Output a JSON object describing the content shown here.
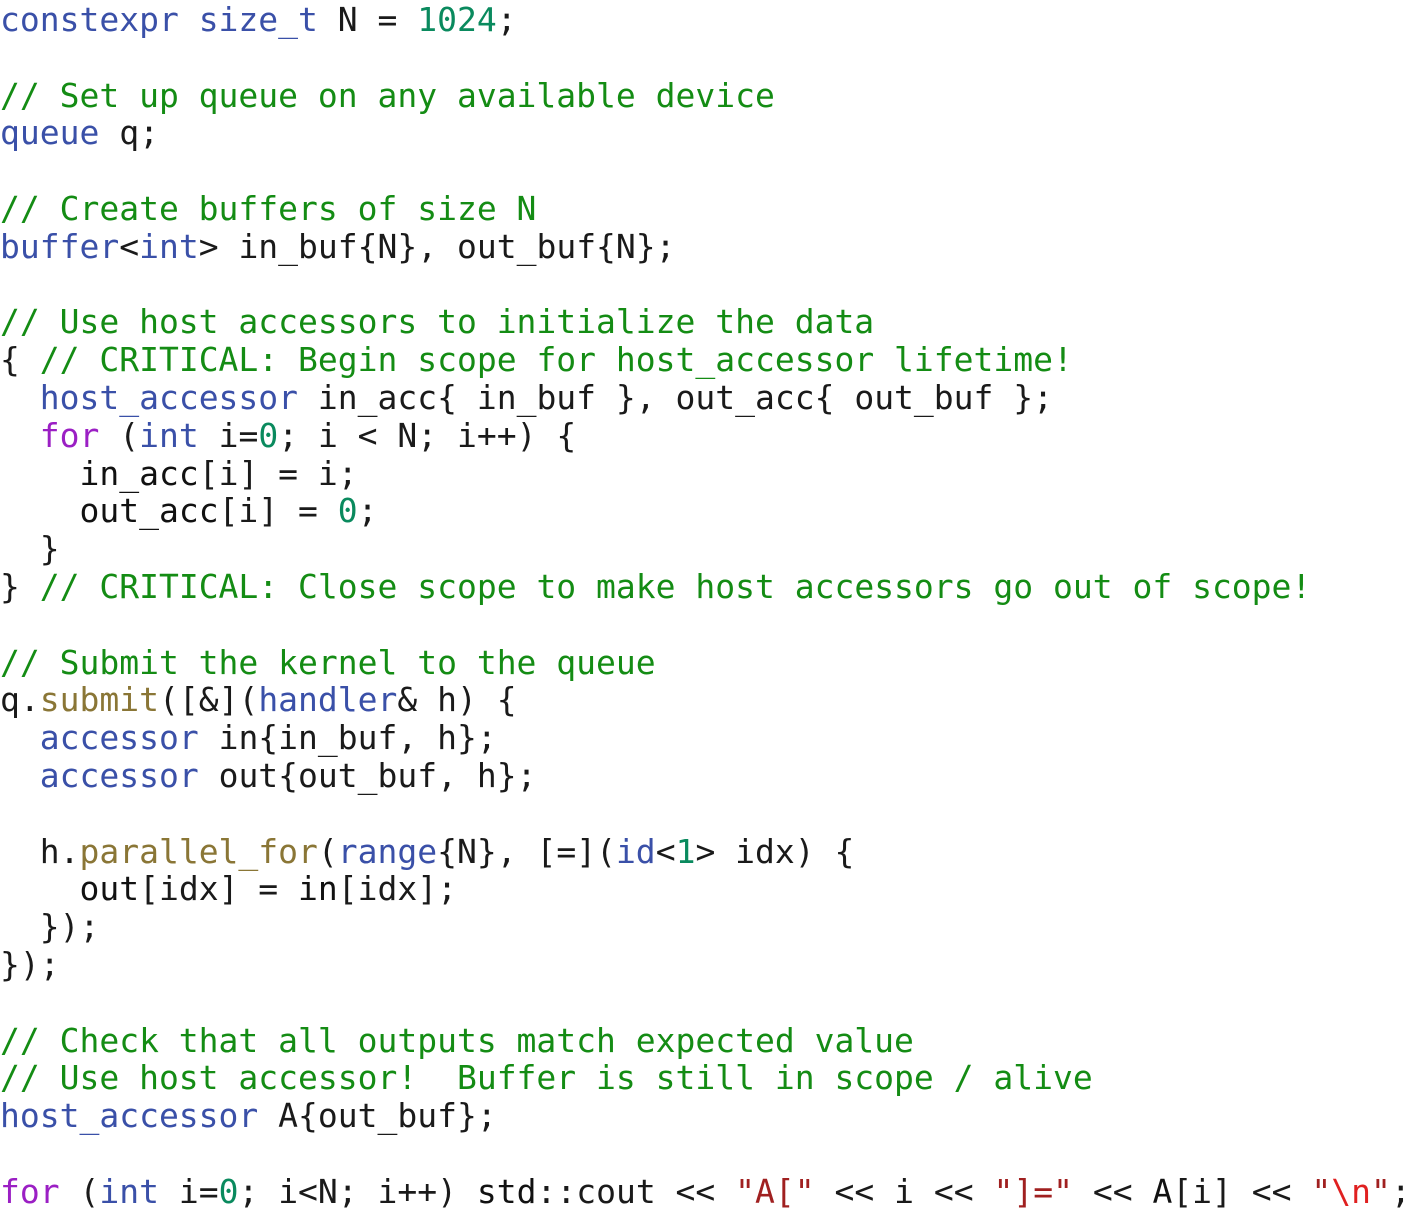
{
  "editor": {
    "language": "C++ / SYCL",
    "background": "#ffffff",
    "font_size_px": 33,
    "line_height_px": 37.8
  },
  "colors": {
    "plain": "#1a1a1a",
    "keyword": "#9b1fc4",
    "type": "#3a50a8",
    "comment": "#148c14",
    "number": "#0a8a5e",
    "method": "#8a7636",
    "namespace": "#4e8fb4",
    "string": "#a02020",
    "escape": "#e02020",
    "variable": "#3a50a8"
  },
  "code": {
    "lines": [
      {
        "index": 1,
        "text": "constexpr size_t N = 1024;",
        "tokens": [
          {
            "t": "constexpr",
            "c": "type"
          },
          {
            "t": " ",
            "c": "plain"
          },
          {
            "t": "size_t",
            "c": "type"
          },
          {
            "t": " N = ",
            "c": "plain"
          },
          {
            "t": "1024",
            "c": "number"
          },
          {
            "t": ";",
            "c": "plain"
          }
        ]
      },
      {
        "index": 2,
        "text": "",
        "tokens": []
      },
      {
        "index": 3,
        "text": "// Set up queue on any available device",
        "tokens": [
          {
            "t": "// Set up queue on any available device",
            "c": "comment"
          }
        ]
      },
      {
        "index": 4,
        "text": "queue q;",
        "tokens": [
          {
            "t": "queue",
            "c": "type"
          },
          {
            "t": " q;",
            "c": "plain"
          }
        ]
      },
      {
        "index": 5,
        "text": "",
        "tokens": []
      },
      {
        "index": 6,
        "text": "// Create buffers of size N",
        "tokens": [
          {
            "t": "// Create buffers of size N",
            "c": "comment"
          }
        ]
      },
      {
        "index": 7,
        "text": "buffer<int> in_buf{N}, out_buf{N};",
        "tokens": [
          {
            "t": "buffer",
            "c": "type"
          },
          {
            "t": "<",
            "c": "plain"
          },
          {
            "t": "int",
            "c": "type"
          },
          {
            "t": "> in_buf{N}, out_buf{N};",
            "c": "plain"
          }
        ]
      },
      {
        "index": 8,
        "text": "",
        "tokens": []
      },
      {
        "index": 9,
        "text": "// Use host accessors to initialize the data",
        "tokens": [
          {
            "t": "// Use host accessors to initialize the data",
            "c": "comment"
          }
        ]
      },
      {
        "index": 10,
        "text": "{ // CRITICAL: Begin scope for host_accessor lifetime!",
        "tokens": [
          {
            "t": "{ ",
            "c": "plain"
          },
          {
            "t": "// CRITICAL: Begin scope for host_accessor lifetime!",
            "c": "comment"
          }
        ]
      },
      {
        "index": 11,
        "text": "  host_accessor in_acc{ in_buf }, out_acc{ out_buf };",
        "tokens": [
          {
            "t": "  ",
            "c": "plain"
          },
          {
            "t": "host_accessor",
            "c": "type"
          },
          {
            "t": " in_acc{ in_buf }, out_acc{ out_buf };",
            "c": "plain"
          }
        ]
      },
      {
        "index": 12,
        "text": "  for (int i=0; i < N; i++) {",
        "tokens": [
          {
            "t": "  ",
            "c": "plain"
          },
          {
            "t": "for",
            "c": "keyword"
          },
          {
            "t": " (",
            "c": "plain"
          },
          {
            "t": "int",
            "c": "type"
          },
          {
            "t": " i=",
            "c": "plain"
          },
          {
            "t": "0",
            "c": "number"
          },
          {
            "t": "; i < N; i++) {",
            "c": "plain"
          }
        ]
      },
      {
        "index": 13,
        "text": "    in_acc[i] = i;",
        "tokens": [
          {
            "t": "    ",
            "c": "plain"
          },
          {
            "t": "in_acc",
            "c": "variable"
          },
          {
            "t": "[i] = i;",
            "c": "plain"
          }
        ]
      },
      {
        "index": 14,
        "text": "    out_acc[i] = 0;",
        "tokens": [
          {
            "t": "    ",
            "c": "plain"
          },
          {
            "t": "out_acc",
            "c": "variable"
          },
          {
            "t": "[i] = ",
            "c": "plain"
          },
          {
            "t": "0",
            "c": "number"
          },
          {
            "t": ";",
            "c": "plain"
          }
        ]
      },
      {
        "index": 15,
        "text": "  }",
        "tokens": [
          {
            "t": "  }",
            "c": "plain"
          }
        ]
      },
      {
        "index": 16,
        "text": "} // CRITICAL: Close scope to make host accessors go out of scope!",
        "tokens": [
          {
            "t": "} ",
            "c": "plain"
          },
          {
            "t": "// CRITICAL: Close scope to make host accessors go out of scope!",
            "c": "comment"
          }
        ]
      },
      {
        "index": 17,
        "text": "",
        "tokens": []
      },
      {
        "index": 18,
        "text": "// Submit the kernel to the queue",
        "tokens": [
          {
            "t": "// Submit the kernel to the queue",
            "c": "comment"
          }
        ]
      },
      {
        "index": 19,
        "text": "q.submit([&](handler& h) {",
        "tokens": [
          {
            "t": "q.",
            "c": "plain"
          },
          {
            "t": "submit",
            "c": "method"
          },
          {
            "t": "([&](",
            "c": "plain"
          },
          {
            "t": "handler",
            "c": "type"
          },
          {
            "t": "& h) {",
            "c": "plain"
          }
        ]
      },
      {
        "index": 20,
        "text": "  accessor in{in_buf, h};",
        "tokens": [
          {
            "t": "  ",
            "c": "plain"
          },
          {
            "t": "accessor",
            "c": "type"
          },
          {
            "t": " in{in_buf, h};",
            "c": "plain"
          }
        ]
      },
      {
        "index": 21,
        "text": "  accessor out{out_buf, h};",
        "tokens": [
          {
            "t": "  ",
            "c": "plain"
          },
          {
            "t": "accessor",
            "c": "type"
          },
          {
            "t": " out{out_buf, h};",
            "c": "plain"
          }
        ]
      },
      {
        "index": 22,
        "text": "",
        "tokens": []
      },
      {
        "index": 23,
        "text": "  h.parallel_for(range{N}, [=](id<1> idx) {",
        "tokens": [
          {
            "t": "  h.",
            "c": "plain"
          },
          {
            "t": "parallel_for",
            "c": "method"
          },
          {
            "t": "(",
            "c": "plain"
          },
          {
            "t": "range",
            "c": "type"
          },
          {
            "t": "{N}, [=](",
            "c": "plain"
          },
          {
            "t": "id",
            "c": "type"
          },
          {
            "t": "<",
            "c": "plain"
          },
          {
            "t": "1",
            "c": "number"
          },
          {
            "t": "> idx) {",
            "c": "plain"
          }
        ]
      },
      {
        "index": 24,
        "text": "    out[idx] = in[idx];",
        "tokens": [
          {
            "t": "    ",
            "c": "plain"
          },
          {
            "t": "out",
            "c": "variable"
          },
          {
            "t": "[idx] = ",
            "c": "plain"
          },
          {
            "t": "in",
            "c": "variable"
          },
          {
            "t": "[idx];",
            "c": "plain"
          }
        ]
      },
      {
        "index": 25,
        "text": "  });",
        "tokens": [
          {
            "t": "  });",
            "c": "plain"
          }
        ]
      },
      {
        "index": 26,
        "text": "});",
        "tokens": [
          {
            "t": "});",
            "c": "plain"
          }
        ]
      },
      {
        "index": 27,
        "text": "",
        "tokens": []
      },
      {
        "index": 28,
        "text": "// Check that all outputs match expected value",
        "tokens": [
          {
            "t": "// Check that all outputs match expected value",
            "c": "comment"
          }
        ]
      },
      {
        "index": 29,
        "text": "// Use host accessor!  Buffer is still in scope / alive",
        "tokens": [
          {
            "t": "// Use host accessor!  Buffer is still in scope / alive",
            "c": "comment"
          }
        ]
      },
      {
        "index": 30,
        "text": "host_accessor A{out_buf};",
        "tokens": [
          {
            "t": "host_accessor",
            "c": "type"
          },
          {
            "t": " A{out_buf};",
            "c": "plain"
          }
        ]
      },
      {
        "index": 31,
        "text": "",
        "tokens": []
      },
      {
        "index": 32,
        "text": "for (int i=0; i<N; i++) std::cout << \"A[\" << i << \"]=\" << A[i] << \"\\n\";",
        "tokens": [
          {
            "t": "for",
            "c": "keyword"
          },
          {
            "t": " (",
            "c": "plain"
          },
          {
            "t": "int",
            "c": "type"
          },
          {
            "t": " i=",
            "c": "plain"
          },
          {
            "t": "0",
            "c": "number"
          },
          {
            "t": "; i<N; i++) ",
            "c": "plain"
          },
          {
            "t": "std",
            "c": "namespace"
          },
          {
            "t": "::cout << ",
            "c": "plain"
          },
          {
            "t": "\"A[\"",
            "c": "string"
          },
          {
            "t": " << i << ",
            "c": "plain"
          },
          {
            "t": "\"]=\"",
            "c": "string"
          },
          {
            "t": " << ",
            "c": "plain"
          },
          {
            "t": "A",
            "c": "variable"
          },
          {
            "t": "[i] << ",
            "c": "plain"
          },
          {
            "t": "\"",
            "c": "string"
          },
          {
            "t": "\\n",
            "c": "escape"
          },
          {
            "t": "\"",
            "c": "string"
          },
          {
            "t": ";",
            "c": "plain"
          }
        ]
      }
    ]
  }
}
